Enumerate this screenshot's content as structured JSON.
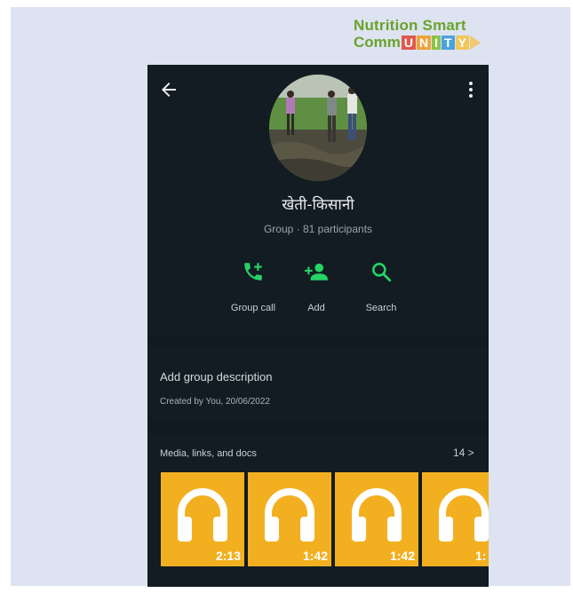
{
  "logo": {
    "line1": "Nutrition Smart",
    "comm": "Comm",
    "letters": [
      "U",
      "N",
      "I",
      "T",
      "Y"
    ],
    "letter_colors": [
      "#e2574c",
      "#f0a33a",
      "#8bc34a",
      "#4aa3df",
      "#f2c65a"
    ]
  },
  "header": {
    "back_icon": "arrow-left-icon",
    "menu_icon": "more-vertical-icon"
  },
  "group": {
    "name": "खेती-किसानी",
    "meta": "Group · 81 participants"
  },
  "actions": [
    {
      "label": "Group call",
      "icon": "phone-add-icon"
    },
    {
      "label": "Add",
      "icon": "person-add-icon"
    },
    {
      "label": "Search",
      "icon": "search-icon"
    }
  ],
  "description": {
    "title": "Add group description",
    "created": "Created by You, 20/06/2022"
  },
  "media": {
    "header": "Media, links, and docs",
    "count": "14 >",
    "items": [
      {
        "duration": "2:13",
        "icon": "headphones-icon"
      },
      {
        "duration": "1:42",
        "icon": "headphones-icon"
      },
      {
        "duration": "1:42",
        "icon": "headphones-icon"
      },
      {
        "duration": "1:",
        "icon": "headphones-icon"
      }
    ]
  },
  "colors": {
    "accent": "#25d366",
    "tile": "#f2b021",
    "background": "#121c22"
  }
}
